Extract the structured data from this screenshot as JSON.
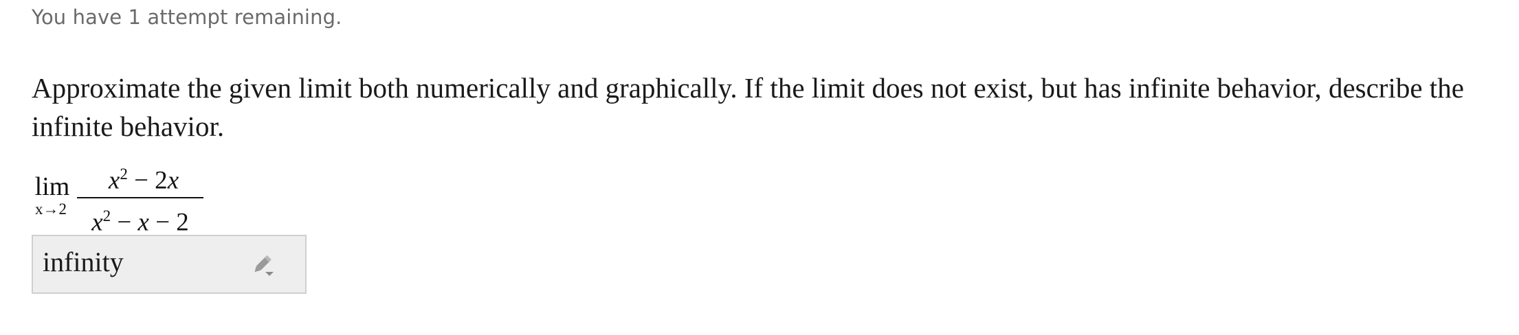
{
  "status": {
    "attempts_text": "You have 1 attempt remaining."
  },
  "question": {
    "prompt": "Approximate the given limit both numerically and graphically. If the limit does not exist, but has infinite behavior, describe the infinite behavior.",
    "limit": {
      "operator": "lim",
      "subscript": "x→2",
      "numerator": "x² − 2x",
      "denominator": "x² − x − 2"
    }
  },
  "answer": {
    "value": "infinity",
    "edit_icon": "pencil-dropdown-icon"
  }
}
